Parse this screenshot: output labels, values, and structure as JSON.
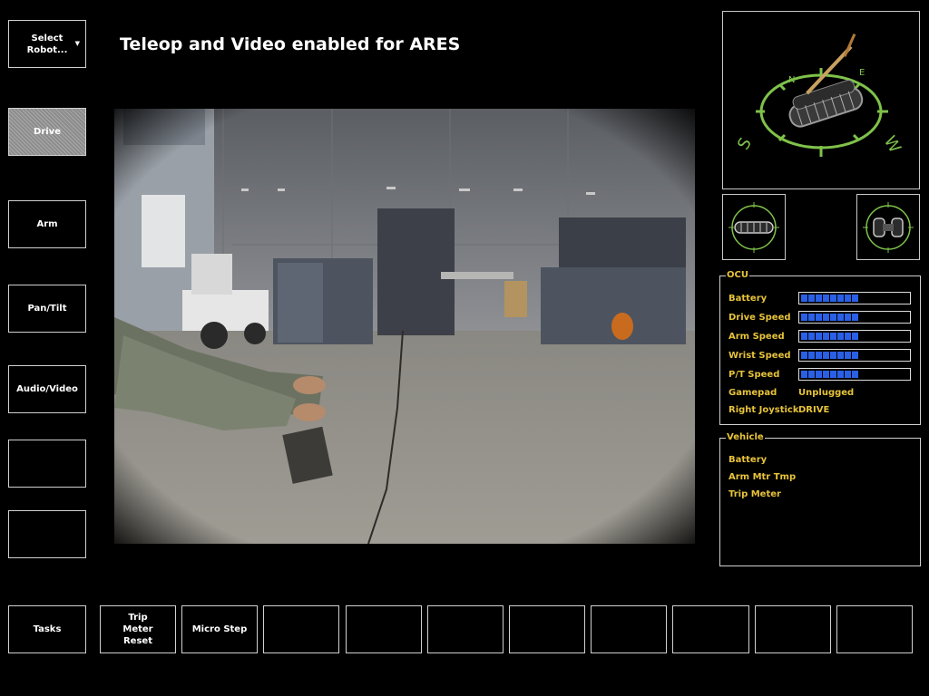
{
  "title": "Teleop and Video enabled for ARES",
  "left_buttons": {
    "select_robot": "Select\nRobot...",
    "drive": "Drive",
    "arm": "Arm",
    "pan_tilt": "Pan/Tilt",
    "audio_video": "Audio/Video",
    "blank1": "",
    "blank2": ""
  },
  "bottom_buttons": {
    "tasks": "Tasks",
    "trip_meter_reset": "Trip\nMeter\nReset",
    "micro_step": "Micro Step"
  },
  "ocu": {
    "title": "OCU",
    "battery_label": "Battery",
    "drive_speed_label": "Drive Speed",
    "arm_speed_label": "Arm Speed",
    "wrist_speed_label": "Wrist Speed",
    "pt_speed_label": "P/T Speed",
    "gamepad_label": "Gamepad",
    "gamepad_value": "Unplugged",
    "right_joystick_label": "Right Joystick",
    "right_joystick_value": "DRIVE",
    "levels": {
      "battery": 0.5,
      "drive_speed": 0.5,
      "arm_speed": 0.5,
      "wrist_speed": 0.5,
      "pt_speed": 0.5
    }
  },
  "vehicle": {
    "title": "Vehicle",
    "battery_label": "Battery",
    "arm_mtr_tmp_label": "Arm Mtr Tmp",
    "trip_meter_label": "Trip Meter"
  },
  "colors": {
    "accent": "#e7c33a",
    "bar": "#2a60e6",
    "border": "#d0d0d0",
    "compass": "#7fc24a"
  },
  "icons": {
    "robot_view": "robot-3d-compass-icon",
    "track_front": "track-front-view-icon",
    "track_side": "track-side-view-icon",
    "dropdown": "chevron-down-icon"
  },
  "compass_labels": [
    "N",
    "E",
    "S",
    "W"
  ]
}
